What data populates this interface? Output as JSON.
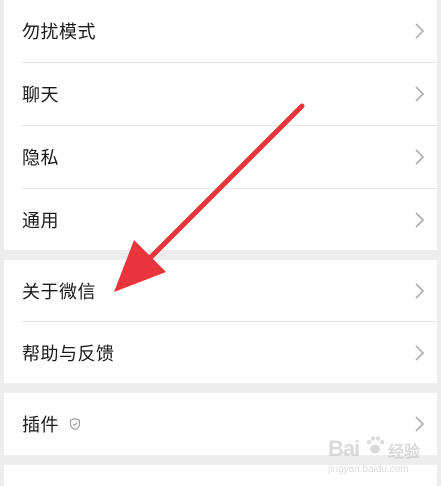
{
  "settings": {
    "group1": {
      "items": [
        {
          "label": "勿扰模式"
        },
        {
          "label": "聊天"
        },
        {
          "label": "隐私"
        },
        {
          "label": "通用"
        }
      ]
    },
    "group2": {
      "items": [
        {
          "label": "关于微信"
        },
        {
          "label": "帮助与反馈"
        }
      ]
    },
    "group3": {
      "items": [
        {
          "label": "插件"
        }
      ]
    }
  },
  "icons": {
    "row_chevron": "chevron-right-icon",
    "plugin_badge": "shield-icon",
    "annotation": "red-arrow"
  },
  "colors": {
    "background": "#ededed",
    "card": "#ffffff",
    "text": "#1a1a1a",
    "chevron": "#b2b2b2",
    "divider": "#e6e6e6",
    "arrow": "#e8343a"
  },
  "watermark": {
    "logo": "Bai",
    "sub": "经验",
    "url": "jingyan.baidu.com"
  }
}
